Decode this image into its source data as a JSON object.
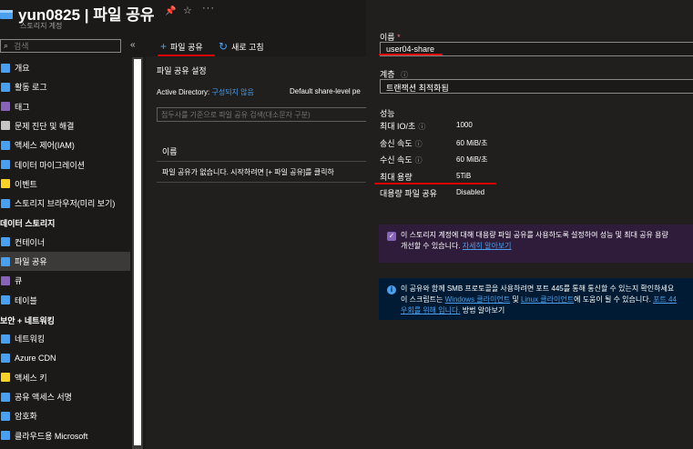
{
  "header": {
    "title": "yun0825 | 파일 공유",
    "subtitle": "스토리지 계정"
  },
  "sidebar": {
    "search_placeholder": "검색",
    "collapse": "«",
    "items_top": [
      {
        "label": "개요",
        "icon": "overview-icon",
        "color": "#4aa0ef"
      },
      {
        "label": "활동 로그",
        "icon": "activity-log-icon",
        "color": "#4aa0ef"
      },
      {
        "label": "태그",
        "icon": "tag-icon",
        "color": "#8764b8"
      },
      {
        "label": "문제 진단 및 해결",
        "icon": "wrench-icon",
        "color": "#c8c6c4"
      },
      {
        "label": "액세스 제어(IAM)",
        "icon": "iam-icon",
        "color": "#4aa0ef"
      },
      {
        "label": "데이터 마이그레이션",
        "icon": "migration-icon",
        "color": "#4aa0ef"
      },
      {
        "label": "이벤트",
        "icon": "lightning-icon",
        "color": "#f8d22a"
      },
      {
        "label": "스토리지 브라우저(미리 보기)",
        "icon": "storage-browser-icon",
        "color": "#4aa0ef"
      }
    ],
    "section_data": "데이터 스토리지",
    "items_data": [
      {
        "label": "컨테이너",
        "icon": "container-icon",
        "color": "#4aa0ef"
      },
      {
        "label": "파일 공유",
        "icon": "file-share-icon",
        "color": "#4aa0ef",
        "active": true
      },
      {
        "label": "큐",
        "icon": "queue-icon",
        "color": "#8764b8"
      },
      {
        "label": "테이블",
        "icon": "table-icon",
        "color": "#4aa0ef"
      }
    ],
    "section_security": "보안 + 네트워킹",
    "items_security": [
      {
        "label": "네트워킹",
        "icon": "networking-icon",
        "color": "#4aa0ef"
      },
      {
        "label": "Azure CDN",
        "icon": "cdn-icon",
        "color": "#4aa0ef"
      },
      {
        "label": "액세스 키",
        "icon": "key-icon",
        "color": "#f8d22a"
      },
      {
        "label": "공유 액세스 서명",
        "icon": "link-icon",
        "color": "#4aa0ef"
      },
      {
        "label": "암호화",
        "icon": "lock-icon",
        "color": "#4aa0ef"
      },
      {
        "label": "클라우드용 Microsoft",
        "icon": "defender-icon",
        "color": "#4aa0ef"
      }
    ]
  },
  "toolbar": {
    "add_label": "파일 공유",
    "refresh_label": "새로 고침"
  },
  "middle": {
    "settings_title": "파일 공유 설정",
    "ad_label": "Active Directory:",
    "ad_value": "구성되지 않음",
    "share_perm_label": "Default share-level pe",
    "filter_placeholder": "접두사를 기준으로 파일 공유 검색(대소문자 구분)",
    "column_name": "이름",
    "empty_message": "파일 공유가 없습니다. 시작하려면 [+ 파일 공유]를 클릭하"
  },
  "panel": {
    "name_label": "이름",
    "name_required": "*",
    "name_value": "user04-share",
    "tier_label": "계층",
    "tier_value": "트랜잭션 최적화됨",
    "perf_title": "성능",
    "perf": [
      {
        "label": "최대 IO/초",
        "info": true,
        "value": "1000"
      },
      {
        "label": "송신 속도",
        "info": true,
        "value": "60 MiB/초"
      },
      {
        "label": "수신 속도",
        "info": true,
        "value": "60 MiB/초"
      },
      {
        "label": "최대 용량",
        "info": false,
        "value": "5TiB"
      },
      {
        "label": "대용량 파일 공유",
        "info": false,
        "value": "Disabled"
      }
    ],
    "large_share_info": {
      "line1": "이 스토리지 계정에 대해 대용량 파일 공유를 사용하도록 설정하여 성능 및 최대 공유 용량",
      "line2_text": "개선할 수 있습니다.",
      "line2_link": "자세히 알아보기"
    },
    "smb_info": {
      "line1_a": "이 공유와 함께 SMB 프로토콜을 사용하려면 포트 445를 통해 통신할 수 있는지 확인하세요",
      "line2_a": "이 스크립트는",
      "line2_link1": "Windows 클라이언트",
      "line2_b": "및",
      "line2_link2": "Linux 클라이언트",
      "line2_c": "에 도움이 될 수 있습니다.",
      "line2_link3": "포트 44",
      "line3_link": "우회를 위해 입니다.",
      "line3_b": "방법 알아보기"
    }
  },
  "colors": {
    "accent": "#4aa0ef",
    "highlight": "#e00000",
    "panel_bg": "#201f1e",
    "page_bg": "#1b1a19"
  }
}
